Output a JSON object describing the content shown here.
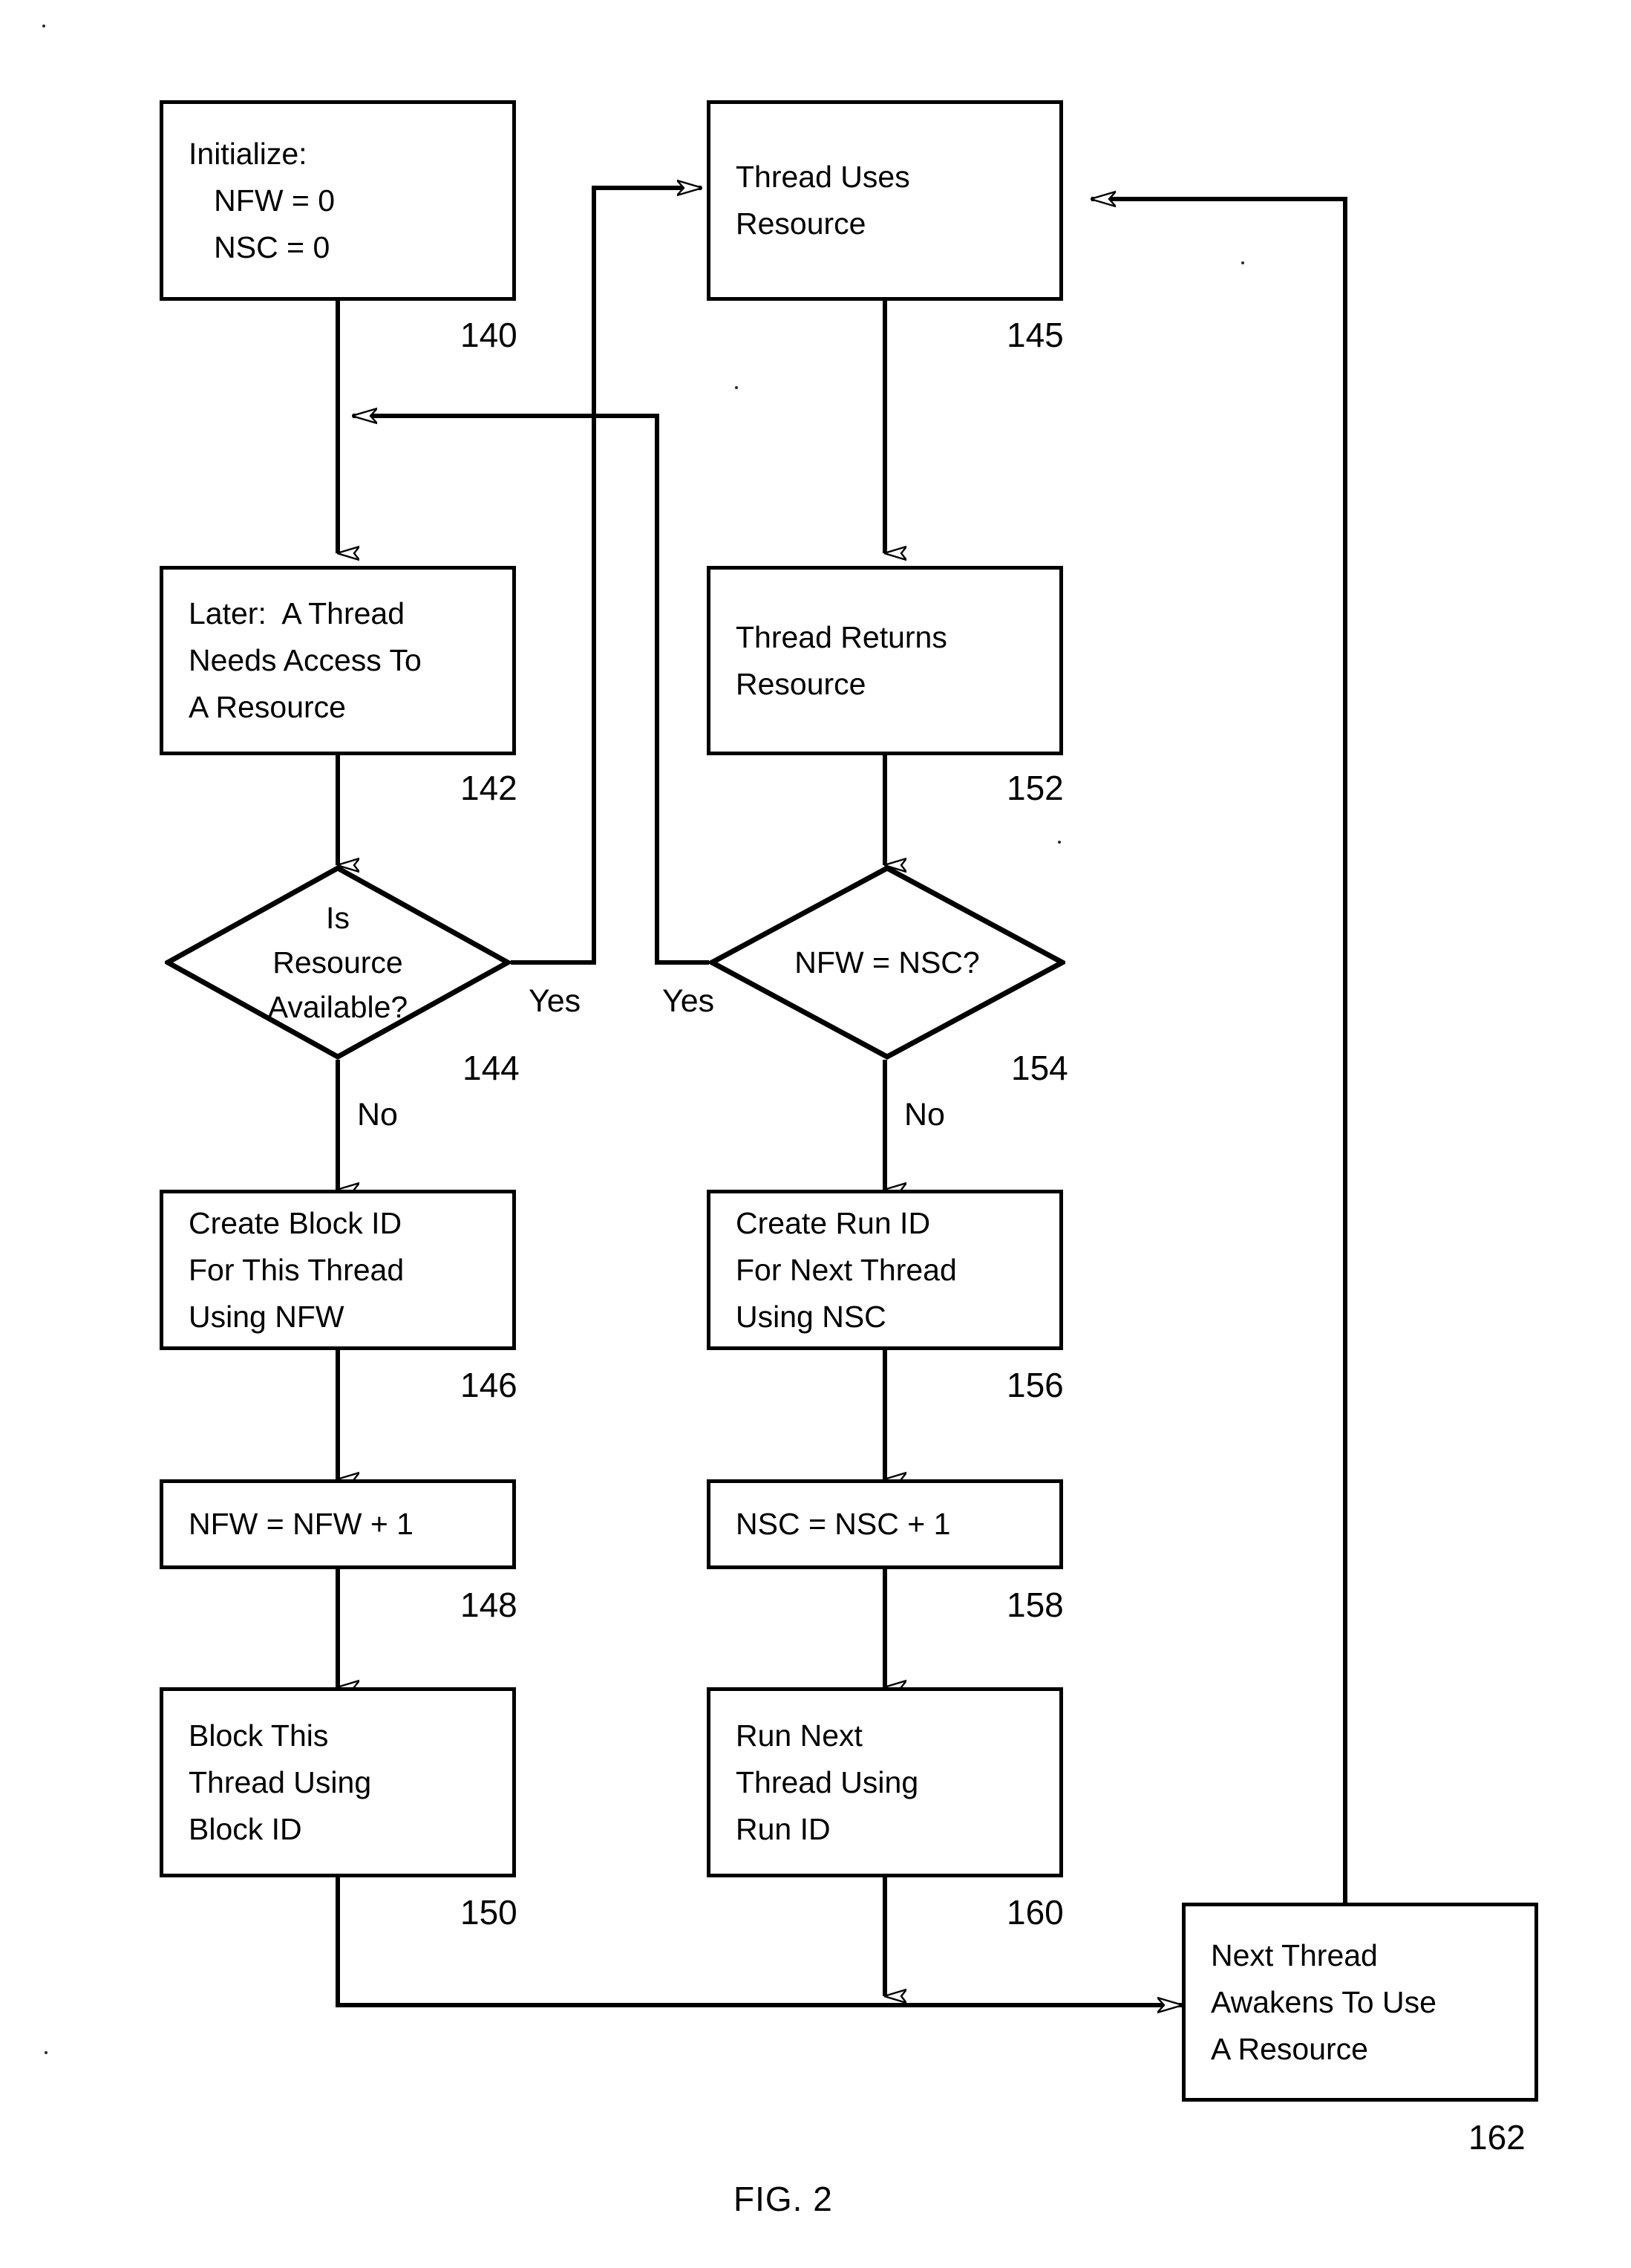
{
  "figure": {
    "caption": "FIG. 2",
    "title": "Thread resource arbitration flowchart"
  },
  "nodes": {
    "initialize": {
      "id": "140",
      "lines": [
        "Initialize:",
        "   NFW = 0",
        "   NSC = 0"
      ]
    },
    "thread_uses_resource": {
      "id": "145",
      "lines": [
        "Thread Uses",
        "Resource"
      ]
    },
    "later_thread_needs": {
      "id": "142",
      "lines": [
        "Later:  A Thread",
        "Needs Access To",
        "A Resource"
      ]
    },
    "thread_returns_resource": {
      "id": "152",
      "lines": [
        "Thread Returns",
        "Resource"
      ]
    },
    "is_resource_available": {
      "id": "144",
      "lines": [
        "Is",
        "Resource",
        "Available?"
      ]
    },
    "nfw_equals_nsc": {
      "id": "154",
      "lines": [
        "NFW = NSC?"
      ]
    },
    "create_block_id": {
      "id": "146",
      "lines": [
        "Create Block ID",
        "For This Thread",
        "Using NFW"
      ]
    },
    "create_run_id": {
      "id": "156",
      "lines": [
        "Create Run ID",
        "For Next Thread",
        "Using NSC"
      ]
    },
    "increment_nfw": {
      "id": "148",
      "lines": [
        "NFW = NFW + 1"
      ]
    },
    "increment_nsc": {
      "id": "158",
      "lines": [
        "NSC = NSC + 1"
      ]
    },
    "block_this_thread": {
      "id": "150",
      "lines": [
        "Block This",
        "Thread Using",
        "Block ID"
      ]
    },
    "run_next_thread": {
      "id": "160",
      "lines": [
        "Run Next",
        "Thread Using",
        "Run ID"
      ]
    },
    "next_thread_awakens": {
      "id": "162",
      "lines": [
        "Next Thread",
        "Awakens To Use",
        "A Resource"
      ]
    }
  },
  "edge_labels": {
    "available_yes": "Yes",
    "available_no": "No",
    "nfw_nsc_yes": "Yes",
    "nfw_nsc_no": "No"
  },
  "colors": {
    "ink": "#000000",
    "paper": "#ffffff"
  }
}
